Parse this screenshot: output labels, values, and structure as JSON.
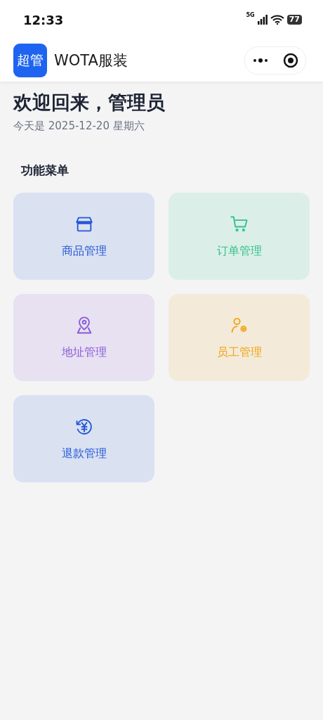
{
  "status_bar": {
    "time": "12:33",
    "network": "5G",
    "battery": "77"
  },
  "header": {
    "logo": "超管",
    "title": "WOTA服装"
  },
  "welcome": {
    "title": "欢迎回来，管理员",
    "date": "今天是 2025-12-20 星期六"
  },
  "menu": {
    "title": "功能菜单",
    "items": [
      {
        "label": "商品管理",
        "kind": "store",
        "color": "#2457d6"
      },
      {
        "label": "订单管理",
        "kind": "cart",
        "color": "#33c28a"
      },
      {
        "label": "地址管理",
        "kind": "location",
        "color": "#8a5ad8"
      },
      {
        "label": "员工管理",
        "kind": "staff",
        "color": "#f0a514"
      },
      {
        "label": "退款管理",
        "kind": "refund",
        "color": "#2457d6"
      }
    ]
  }
}
